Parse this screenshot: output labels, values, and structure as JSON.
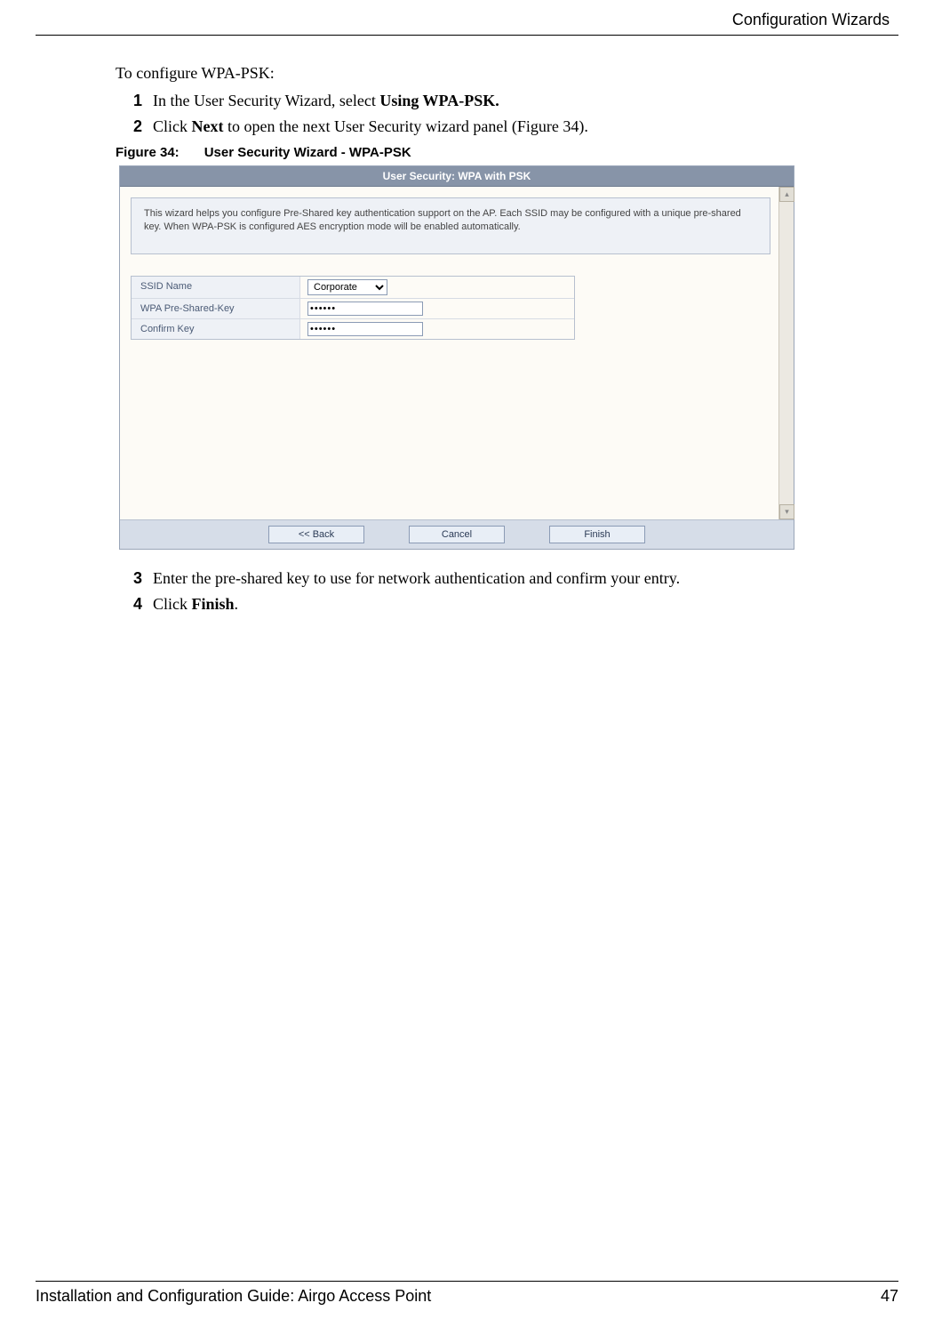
{
  "header": {
    "section": "Configuration Wizards"
  },
  "intro": "To configure WPA-PSK:",
  "steps_a": [
    {
      "num": "1",
      "pre": "In the User Security Wizard, select ",
      "bold": "Using WPA-PSK.",
      "post": ""
    },
    {
      "num": "2",
      "pre": "Click ",
      "bold": "Next",
      "post": " to open the next User Security wizard panel (Figure 34)."
    }
  ],
  "figure": {
    "label": "Figure 34:",
    "title": "User Security Wizard - WPA-PSK"
  },
  "wizard": {
    "title": "User Security: WPA with PSK",
    "description": "This wizard helps you configure Pre-Shared key authentication support on the AP. Each SSID may be configured with a unique pre-shared key. When WPA-PSK is configured AES encryption mode will be enabled automatically.",
    "rows": {
      "ssid_label": "SSID Name",
      "ssid_value": "Corporate",
      "psk_label": "WPA Pre-Shared-Key",
      "psk_value": "••••••",
      "confirm_label": "Confirm Key",
      "confirm_value": "••••••"
    },
    "buttons": {
      "back": "<< Back",
      "cancel": "Cancel",
      "finish": "Finish"
    },
    "scroll_up": "▴",
    "scroll_down": "▾"
  },
  "steps_b": [
    {
      "num": "3",
      "text": "Enter the pre-shared key to use for network authentication and confirm your entry."
    },
    {
      "num": "4",
      "pre": "Click ",
      "bold": "Finish",
      "post": "."
    }
  ],
  "footer": {
    "left": "Installation and Configuration Guide: Airgo Access Point",
    "right": "47"
  }
}
